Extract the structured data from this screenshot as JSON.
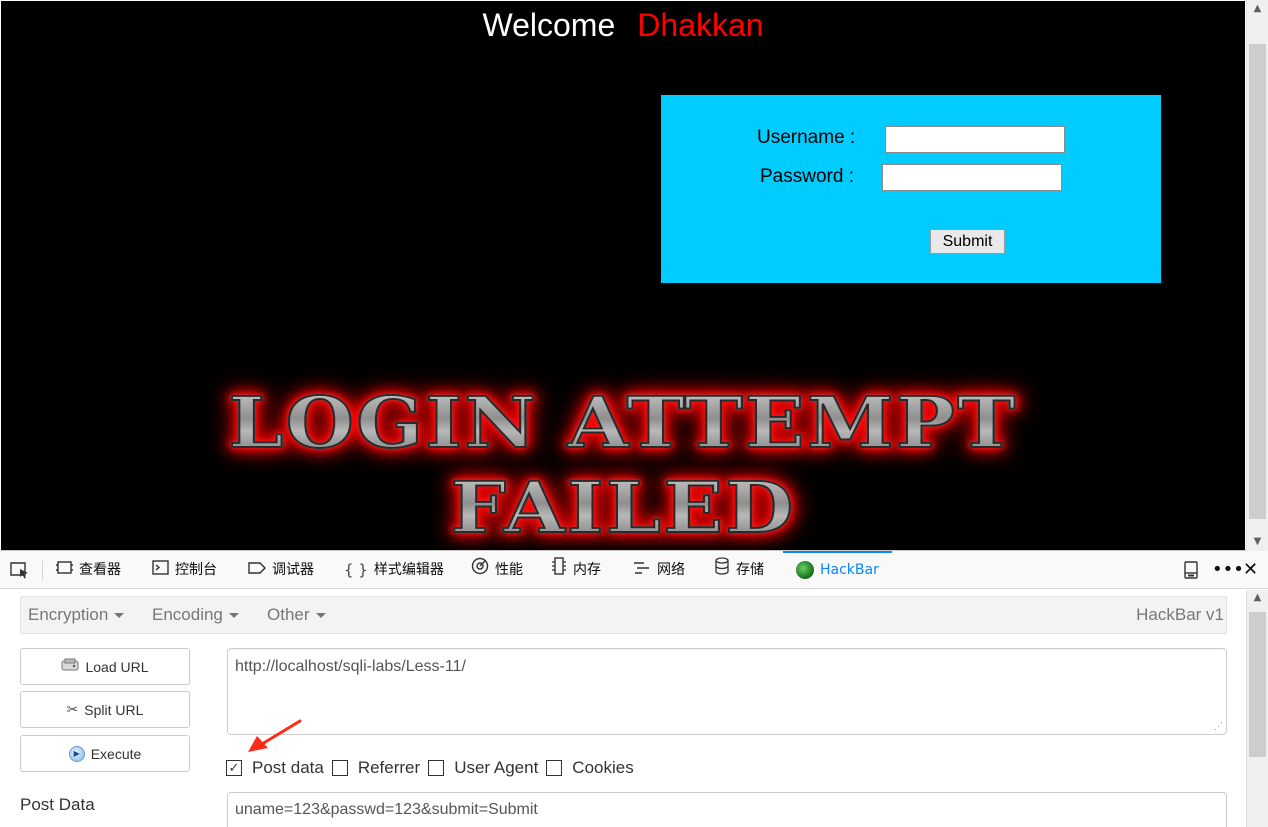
{
  "webpage": {
    "welcome_text": "Welcome",
    "welcome_name": "Dhakkan",
    "username_label": "Username :",
    "password_label": "Password :",
    "submit_label": "Submit",
    "failed_line1": "LOGIN ATTEMPT",
    "failed_line2": "FAILED",
    "colors": {
      "background": "#000000",
      "login_box": "#00ccff",
      "name": "#ff0000"
    }
  },
  "devtools": {
    "tabs": [
      {
        "icon": "inspector-icon",
        "label": "查看器"
      },
      {
        "icon": "console-icon",
        "label": "控制台"
      },
      {
        "icon": "debugger-icon",
        "label": "调试器"
      },
      {
        "icon": "style-editor-icon",
        "label": "样式编辑器"
      },
      {
        "icon": "performance-icon",
        "label": "性能"
      },
      {
        "icon": "memory-icon",
        "label": "内存"
      },
      {
        "icon": "network-icon",
        "label": "网络"
      },
      {
        "icon": "storage-icon",
        "label": "存储"
      },
      {
        "icon": "hackbar-icon",
        "label": "HackBar"
      }
    ],
    "active_tab": "HackBar",
    "accent": "#0a84ff"
  },
  "hackbar": {
    "menu": {
      "encryption": "Encryption",
      "encoding": "Encoding",
      "other": "Other",
      "version": "HackBar v1"
    },
    "buttons": {
      "load_url": "Load URL",
      "split_url": "Split URL",
      "execute": "Execute"
    },
    "url_value": "http://localhost/sqli-labs/Less-11/",
    "options": {
      "post_data": {
        "label": "Post data",
        "checked": true
      },
      "referrer": {
        "label": "Referrer",
        "checked": false
      },
      "user_agent": {
        "label": "User Agent",
        "checked": false
      },
      "cookies": {
        "label": "Cookies",
        "checked": false
      }
    },
    "post_data_label": "Post Data",
    "post_data_value": "uname=123&passwd=123&submit=Submit"
  }
}
